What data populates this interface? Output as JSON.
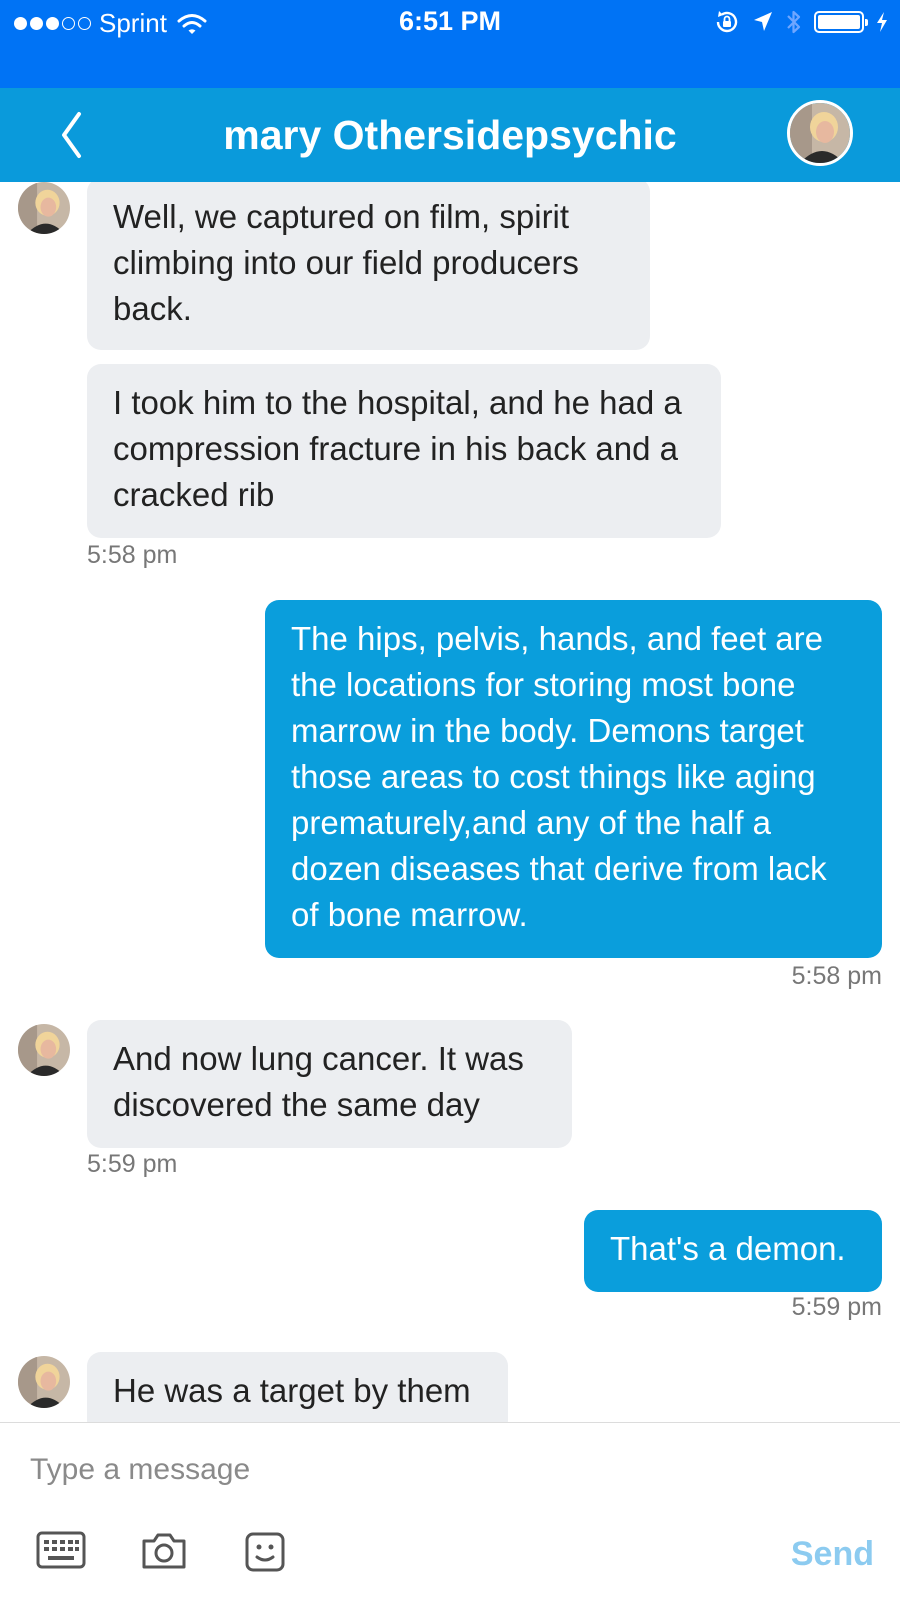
{
  "status_bar": {
    "carrier": "Sprint",
    "time": "6:51 PM",
    "signal_bars_filled": 3,
    "signal_bars_total": 5,
    "battery_level": 1.0
  },
  "header": {
    "title": "mary Othersidepsychic",
    "back_icon": "chevron-left-icon",
    "avatar_icon": "contact-avatar"
  },
  "colors": {
    "status_bar": "#0073f5",
    "header": "#0a9adb",
    "outgoing_bubble": "#0a9edc",
    "incoming_bubble": "#eceef1",
    "send_disabled": "#8ccbf0"
  },
  "messages": [
    {
      "direction": "in",
      "text": "Well, we captured on film, spirit climbing into our field producers back."
    },
    {
      "direction": "in",
      "text": "I took him to the hospital, and he had a compression fracture in his back and a cracked rib",
      "time": "5:58 pm"
    },
    {
      "direction": "out",
      "text": "The hips, pelvis, hands, and feet are the locations for storing most bone marrow in the body. Demons target those areas to cost things like aging prematurely,and any of the half a dozen diseases that derive from lack of bone marrow.",
      "time": "5:58 pm"
    },
    {
      "direction": "in",
      "text": "And now lung cancer. It was discovered the same day",
      "time": "5:59 pm"
    },
    {
      "direction": "out",
      "text": "That's a demon.",
      "time": "5:59 pm"
    },
    {
      "direction": "in",
      "text": "He was a target by them"
    }
  ],
  "compose": {
    "placeholder": "Type a message",
    "send_label": "Send",
    "icons": [
      "keyboard-icon",
      "camera-icon",
      "emoji-icon"
    ]
  }
}
